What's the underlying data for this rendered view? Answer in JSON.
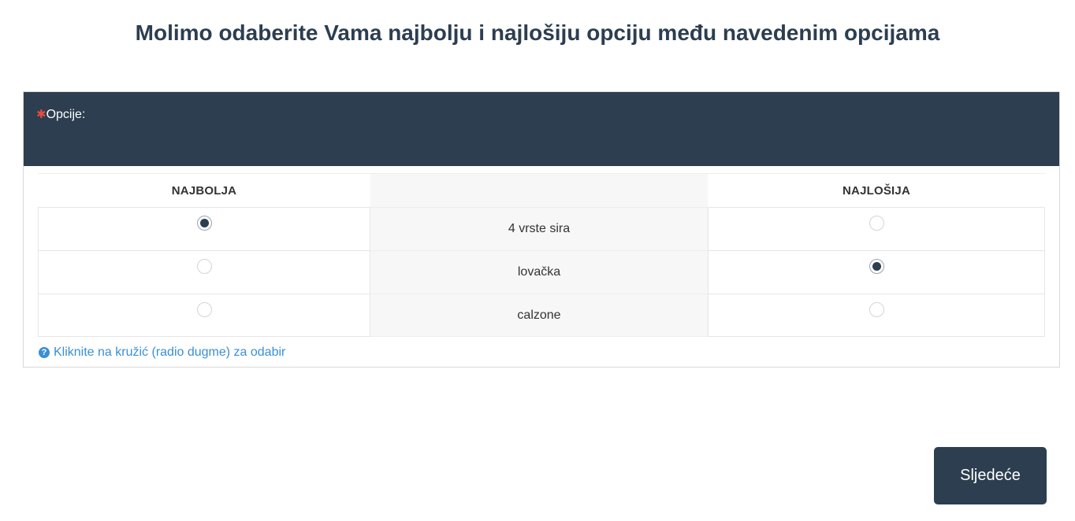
{
  "title": "Molimo odaberite Vama najbolju i najlošiju opciju među navedenim opcijama",
  "question": {
    "required_mark": "✱",
    "label": "Opcije:"
  },
  "columns": {
    "best": "NAJBOLJA",
    "worst": "NAJLOŠIJA"
  },
  "options": [
    {
      "label": "4 vrste sira",
      "best": true,
      "worst": false
    },
    {
      "label": "lovačka",
      "best": false,
      "worst": true
    },
    {
      "label": "calzone",
      "best": false,
      "worst": false
    }
  ],
  "hint": {
    "icon": "?",
    "text": "Kliknite na kružić (radio dugme) za odabir"
  },
  "next_button": "Sljedeće",
  "colors": {
    "header_bg": "#2c3e50",
    "accent_link": "#3a8fd6",
    "required": "#e74c3c"
  }
}
